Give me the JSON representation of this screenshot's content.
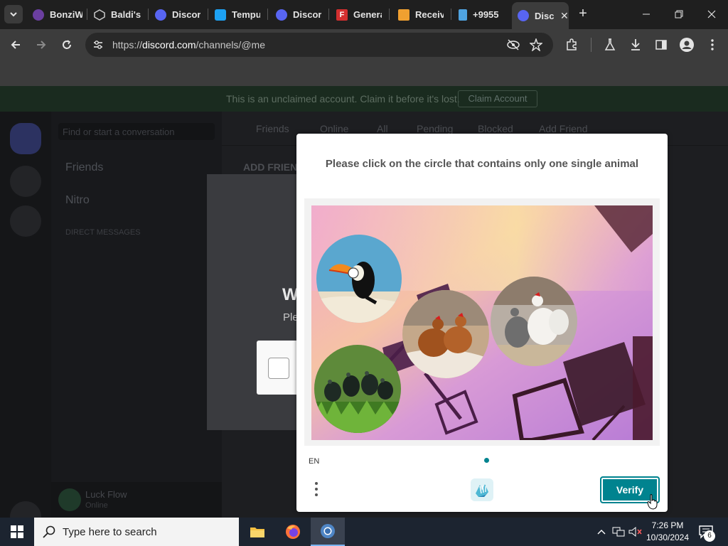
{
  "browser": {
    "tabs": [
      {
        "label": "BonziW",
        "icon": "bonzi-favicon"
      },
      {
        "label": "Baldi's",
        "icon": "baldi-favicon"
      },
      {
        "label": "Discord",
        "icon": "discord-favicon"
      },
      {
        "label": "Tempu",
        "icon": "tempu-favicon"
      },
      {
        "label": "Discord",
        "icon": "discord-favicon"
      },
      {
        "label": "Genera",
        "icon": "f-favicon"
      },
      {
        "label": "Receive",
        "icon": "receive-favicon"
      },
      {
        "label": "+9955",
        "icon": "phone-favicon"
      },
      {
        "label": "Disc",
        "icon": "discord-favicon",
        "active": true
      }
    ],
    "url_prefix": "https://",
    "url_host": "discord.com",
    "url_path": "/channels/@me"
  },
  "discord": {
    "banner_text": "This is an unclaimed account. Claim it before it's lost.",
    "claim_button": "Claim Account",
    "find_placeholder": "Find or start a conversation",
    "side_items": [
      "Friends",
      "Nitro"
    ],
    "dm_header": "DIRECT MESSAGES",
    "username": "Luck Flow",
    "user_status": "Online",
    "tabs": [
      "Friends",
      "Online",
      "All",
      "Pending",
      "Blocked",
      "Add Friend"
    ],
    "add_friend_heading": "ADD FRIEND",
    "modal_title_partial": "W",
    "modal_text_partial": "Ple"
  },
  "captcha": {
    "prompt": "Please click on the circle that contains only one single animal",
    "language": "EN",
    "verify_label": "Verify",
    "circles": [
      "toucan",
      "chickens",
      "chickens-group",
      "frogs"
    ],
    "accent_color": "#00838f"
  },
  "taskbar": {
    "search_placeholder": "Type here to search",
    "time": "7:26 PM",
    "date": "10/30/2024",
    "notification_count": "6"
  }
}
